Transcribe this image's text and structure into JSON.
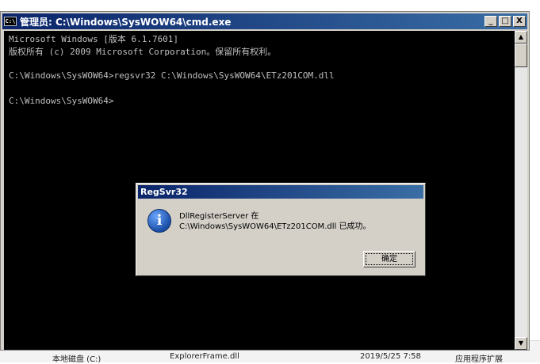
{
  "cmd": {
    "title": "管理员: C:\\Windows\\SysWOW64\\cmd.exe",
    "icon_label": "C:\\",
    "buttons": {
      "minimize": "_",
      "maximize": "□",
      "close": "X"
    },
    "lines": [
      "Microsoft Windows [版本 6.1.7601]",
      "版权所有 (c) 2009 Microsoft Corporation。保留所有权利。",
      "",
      "C:\\Windows\\SysWOW64>regsvr32 C:\\Windows\\SysWOW64\\ETz201COM.dll",
      "",
      "C:\\Windows\\SysWOW64>"
    ],
    "scroll_up": "▲",
    "scroll_down": "▼"
  },
  "dialog": {
    "title": "RegSvr32",
    "message_line1": "DllRegisterServer 在",
    "message_line2": "C:\\Windows\\SysWOW64\\ETz201COM.dll 已成功。",
    "ok_label": "确定",
    "icon_glyph": "i"
  },
  "background": {
    "items": [
      {
        "text": "本地磁盘 (C:)"
      },
      {
        "text": "ExplorerFrame.dll"
      },
      {
        "text": "2019/5/25 7:58"
      },
      {
        "text": "应用程序扩展"
      }
    ]
  }
}
